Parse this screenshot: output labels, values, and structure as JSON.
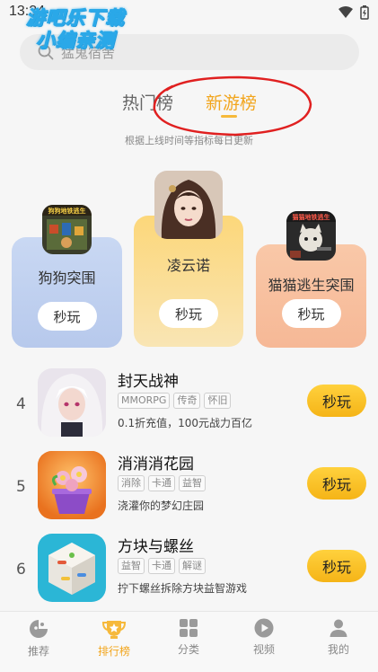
{
  "statusbar": {
    "time": "13:34"
  },
  "watermark": {
    "line1": "游吧乐下载",
    "line2": "小编亲测"
  },
  "search": {
    "placeholder": "猛鬼宿舍",
    "icon": "search-icon"
  },
  "tabs": [
    {
      "label": "热门榜",
      "active": false
    },
    {
      "label": "新游榜",
      "active": true
    }
  ],
  "subtitle": "根据上线时间等指标每日更新",
  "podium": [
    {
      "rank": 1,
      "name": "凌云诺",
      "button": "秒玩"
    },
    {
      "rank": 2,
      "name": "狗狗突围",
      "button": "秒玩",
      "icon_text": "狗狗地铁逃生"
    },
    {
      "rank": 3,
      "name": "猫猫逃生突围",
      "button": "秒玩",
      "icon_text": "猫猫地铁逃生"
    }
  ],
  "list": [
    {
      "rank": "4",
      "name": "封天战神",
      "tags": [
        "MMORPG",
        "传奇",
        "怀旧"
      ],
      "desc": "0.1折充值，100元战力百亿",
      "button": "秒玩"
    },
    {
      "rank": "5",
      "name": "消消消花园",
      "tags": [
        "消除",
        "卡通",
        "益智"
      ],
      "desc": "浇灌你的梦幻庄园",
      "button": "秒玩"
    },
    {
      "rank": "6",
      "name": "方块与螺丝",
      "tags": [
        "益智",
        "卡通",
        "解谜"
      ],
      "desc": "拧下螺丝拆除方块益智游戏",
      "button": "秒玩"
    }
  ],
  "bottom_nav": [
    {
      "label": "推荐",
      "icon": "game-controller-icon",
      "active": false
    },
    {
      "label": "排行榜",
      "icon": "trophy-star-icon",
      "active": true
    },
    {
      "label": "分类",
      "icon": "grid-icon",
      "active": false
    },
    {
      "label": "视频",
      "icon": "play-circle-icon",
      "active": false
    },
    {
      "label": "我的",
      "icon": "user-icon",
      "active": false
    }
  ],
  "colors": {
    "accent": "#f2a51c",
    "button": "#f8c22a",
    "annotation": "#e02020"
  }
}
